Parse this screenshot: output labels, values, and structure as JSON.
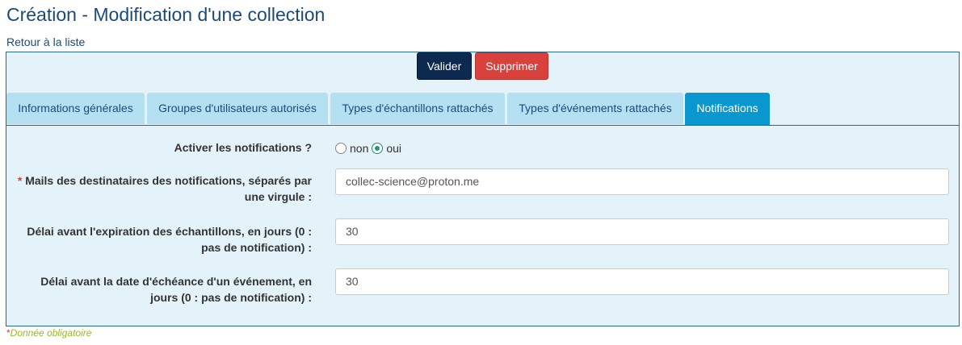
{
  "page": {
    "title": "Création - Modification d'une collection",
    "back_link": "Retour à la liste"
  },
  "toolbar": {
    "validate_label": "Valider",
    "delete_label": "Supprimer"
  },
  "tabs": [
    {
      "label": "Informations générales",
      "active": false
    },
    {
      "label": "Groupes d'utilisateurs autorisés",
      "active": false
    },
    {
      "label": "Types d'échantillons rattachés",
      "active": false
    },
    {
      "label": "Types d'événements rattachés",
      "active": false
    },
    {
      "label": "Notifications",
      "active": true
    }
  ],
  "form": {
    "notifications": {
      "label": "Activer les notifications ?",
      "options": [
        {
          "label": "non",
          "checked": false
        },
        {
          "label": "oui",
          "checked": true
        }
      ]
    },
    "mails": {
      "required_marker": "*",
      "label_line1": "Mails des destinataires des notifications, séparés par",
      "label_line2": "une virgule :",
      "value": "collec-science@proton.me"
    },
    "expiration": {
      "label_line1": "Délai avant l'expiration des échantillons, en jours (0 :",
      "label_line2": "pas de notification) :",
      "value": "30"
    },
    "event_deadline": {
      "label_line1": "Délai avant la date d'échéance d'un événement, en",
      "label_line2": "jours (0 : pas de notification) :",
      "value": "30"
    }
  },
  "footnote": {
    "marker": "*",
    "text": "Donnée obligatoire"
  },
  "colors": {
    "primary": "#0c2a4f",
    "danger": "#d9413c",
    "tab_active": "#0a97cf",
    "tab_inactive": "#b5e0f2",
    "panel_bg": "#e4f3fa"
  }
}
